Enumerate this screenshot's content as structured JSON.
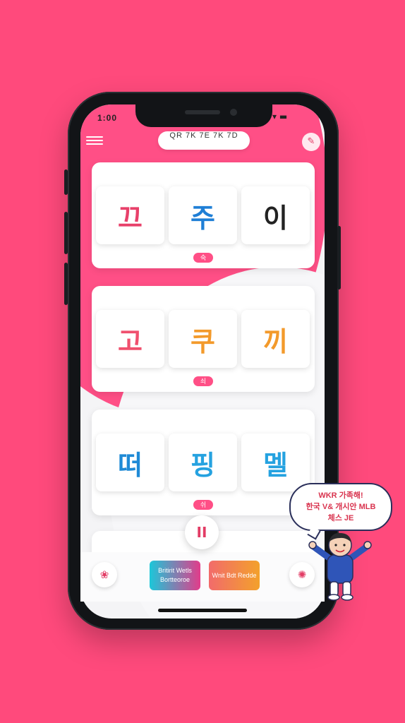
{
  "status_bar": {
    "time": "1:00",
    "icons": "▾ ▬"
  },
  "header": {
    "title": "QR 7K 7E 7K 7D",
    "menu_icon": "hamburger-menu-icon",
    "profile_icon": "profile-icon"
  },
  "cards": [
    {
      "tiles": [
        {
          "char": "끄",
          "color": "#e8406a"
        },
        {
          "char": "주",
          "color": "#1f7fd6"
        },
        {
          "char": "이",
          "color": "#222222"
        }
      ],
      "tag": "숙"
    },
    {
      "tiles": [
        {
          "char": "고",
          "color": "#f0506e"
        },
        {
          "char": "쿠",
          "color": "#f39a2b"
        },
        {
          "char": "끼",
          "color": "#f39a2b"
        }
      ],
      "tag": "쇠"
    },
    {
      "tiles": [
        {
          "char": "떠",
          "color": "#1f8ad6"
        },
        {
          "char": "핑",
          "color": "#25a2e0"
        },
        {
          "char": "멜",
          "color": "#25a2e0"
        }
      ],
      "tag": "쉬"
    }
  ],
  "controls": {
    "pause_label": "II",
    "left_button_icon": "swirl-icon",
    "right_button_icon": "swirl-icon",
    "primary_button": {
      "line1": "Britirit Wetls",
      "line2": "Bortteoroe"
    },
    "secondary_button": {
      "line1": "Wnit Bdt Redde",
      "line2": ""
    }
  },
  "mascot": {
    "speech_line1": "WKR 가족해!",
    "speech_line2": "한국 V& 개시안 MLB",
    "speech_line3": "체스 JE"
  },
  "colors": {
    "background": "#ff4a7c",
    "accent": "#ff4f86",
    "primary_gradient": [
      "#1cc7d9",
      "#e23c8a"
    ],
    "secondary_gradient": [
      "#f26b6b",
      "#f3a12b"
    ]
  }
}
